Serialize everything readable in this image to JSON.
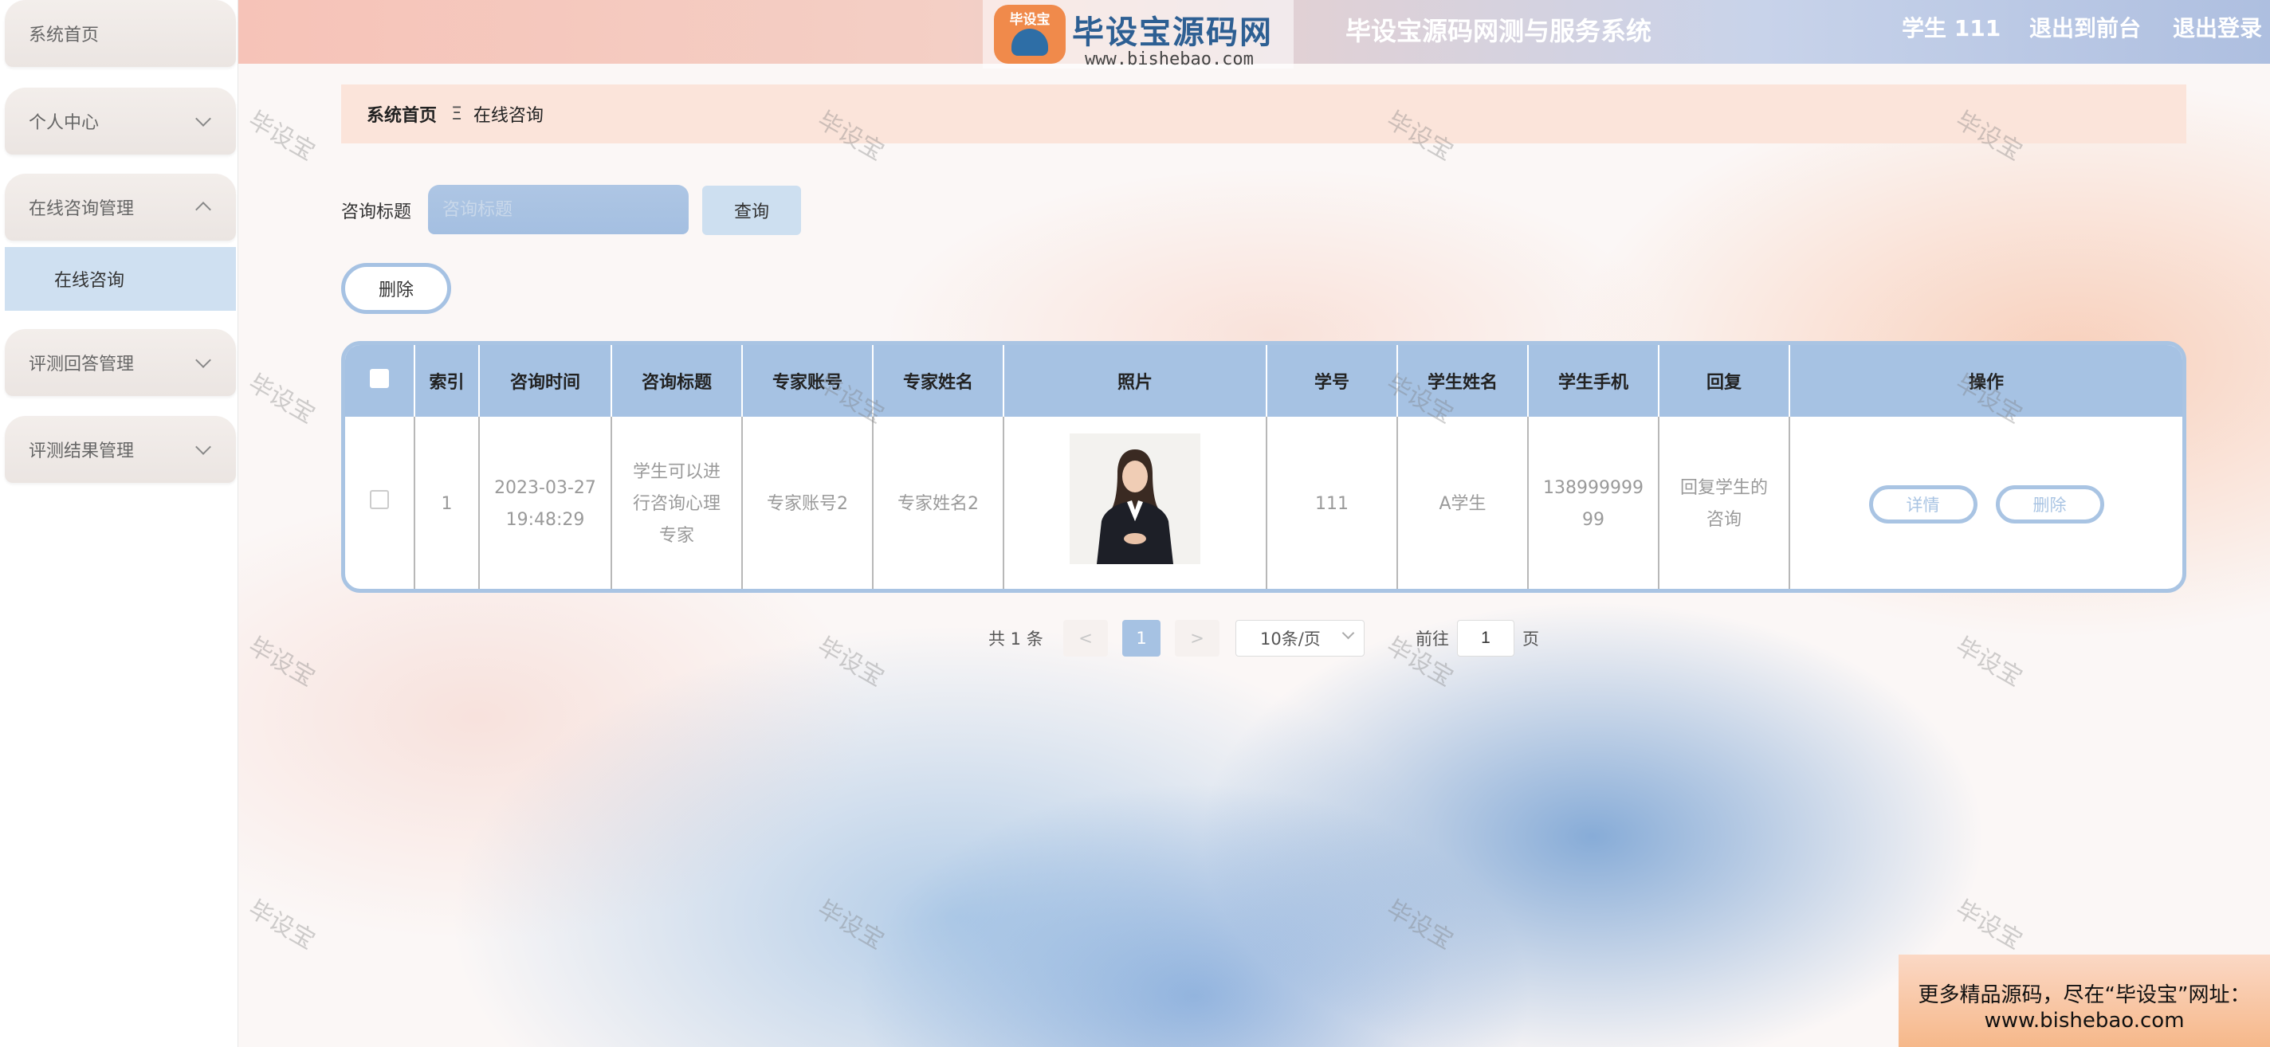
{
  "header": {
    "system_title": "毕设宝源码网测与服务系统",
    "user_label": "学生 111",
    "back_to_front": "退出到前台",
    "logout": "退出登录"
  },
  "logo": {
    "badge_text": "毕设宝",
    "name": "毕设宝源码网",
    "url": "www.bishebao.com"
  },
  "sidebar": {
    "items": [
      {
        "label": "系统首页"
      },
      {
        "label": "个人中心"
      },
      {
        "label": "在线咨询管理"
      },
      {
        "label": "评测回答管理"
      },
      {
        "label": "评测结果管理"
      }
    ],
    "subitem": {
      "label": "在线咨询"
    }
  },
  "breadcrumb": {
    "home": "系统首页",
    "separator": "Ξ",
    "current": "在线咨询"
  },
  "search": {
    "label": "咨询标题",
    "placeholder": "咨询标题",
    "button": "查询"
  },
  "delete_button": "删除",
  "table": {
    "headers": [
      "索引",
      "咨询时间",
      "咨询标题",
      "专家账号",
      "专家姓名",
      "照片",
      "学号",
      "学生姓名",
      "学生手机",
      "回复",
      "操作"
    ],
    "rows": [
      {
        "index": "1",
        "time_date": "2023-03-27",
        "time_clock": "19:48:29",
        "title_l1": "学生可以进",
        "title_l2": "行咨询心理",
        "title_l3": "专家",
        "expert_account": "专家账号2",
        "expert_name": "专家姓名2",
        "student_id": "111",
        "student_name": "A学生",
        "phone_l1": "138999999",
        "phone_l2": "99",
        "reply_l1": "回复学生的",
        "reply_l2": "咨询",
        "detail_btn": "详情",
        "delete_btn": "删除"
      }
    ]
  },
  "pagination": {
    "total": "共 1 条",
    "prev": "<",
    "page": "1",
    "next": ">",
    "page_size": "10条/页",
    "goto_label": "前往",
    "goto_value": "1",
    "goto_unit": "页"
  },
  "watermark": "毕设宝",
  "promo": {
    "line1": "更多精品源码，尽在“毕设宝”网址：",
    "line2": "www.bishebao.com"
  },
  "colors": {
    "accent": "#a6c2e3",
    "header_start": "#f6c3b8",
    "header_end": "#aebfe0",
    "breadcrumb_bg": "#fbe4da"
  }
}
